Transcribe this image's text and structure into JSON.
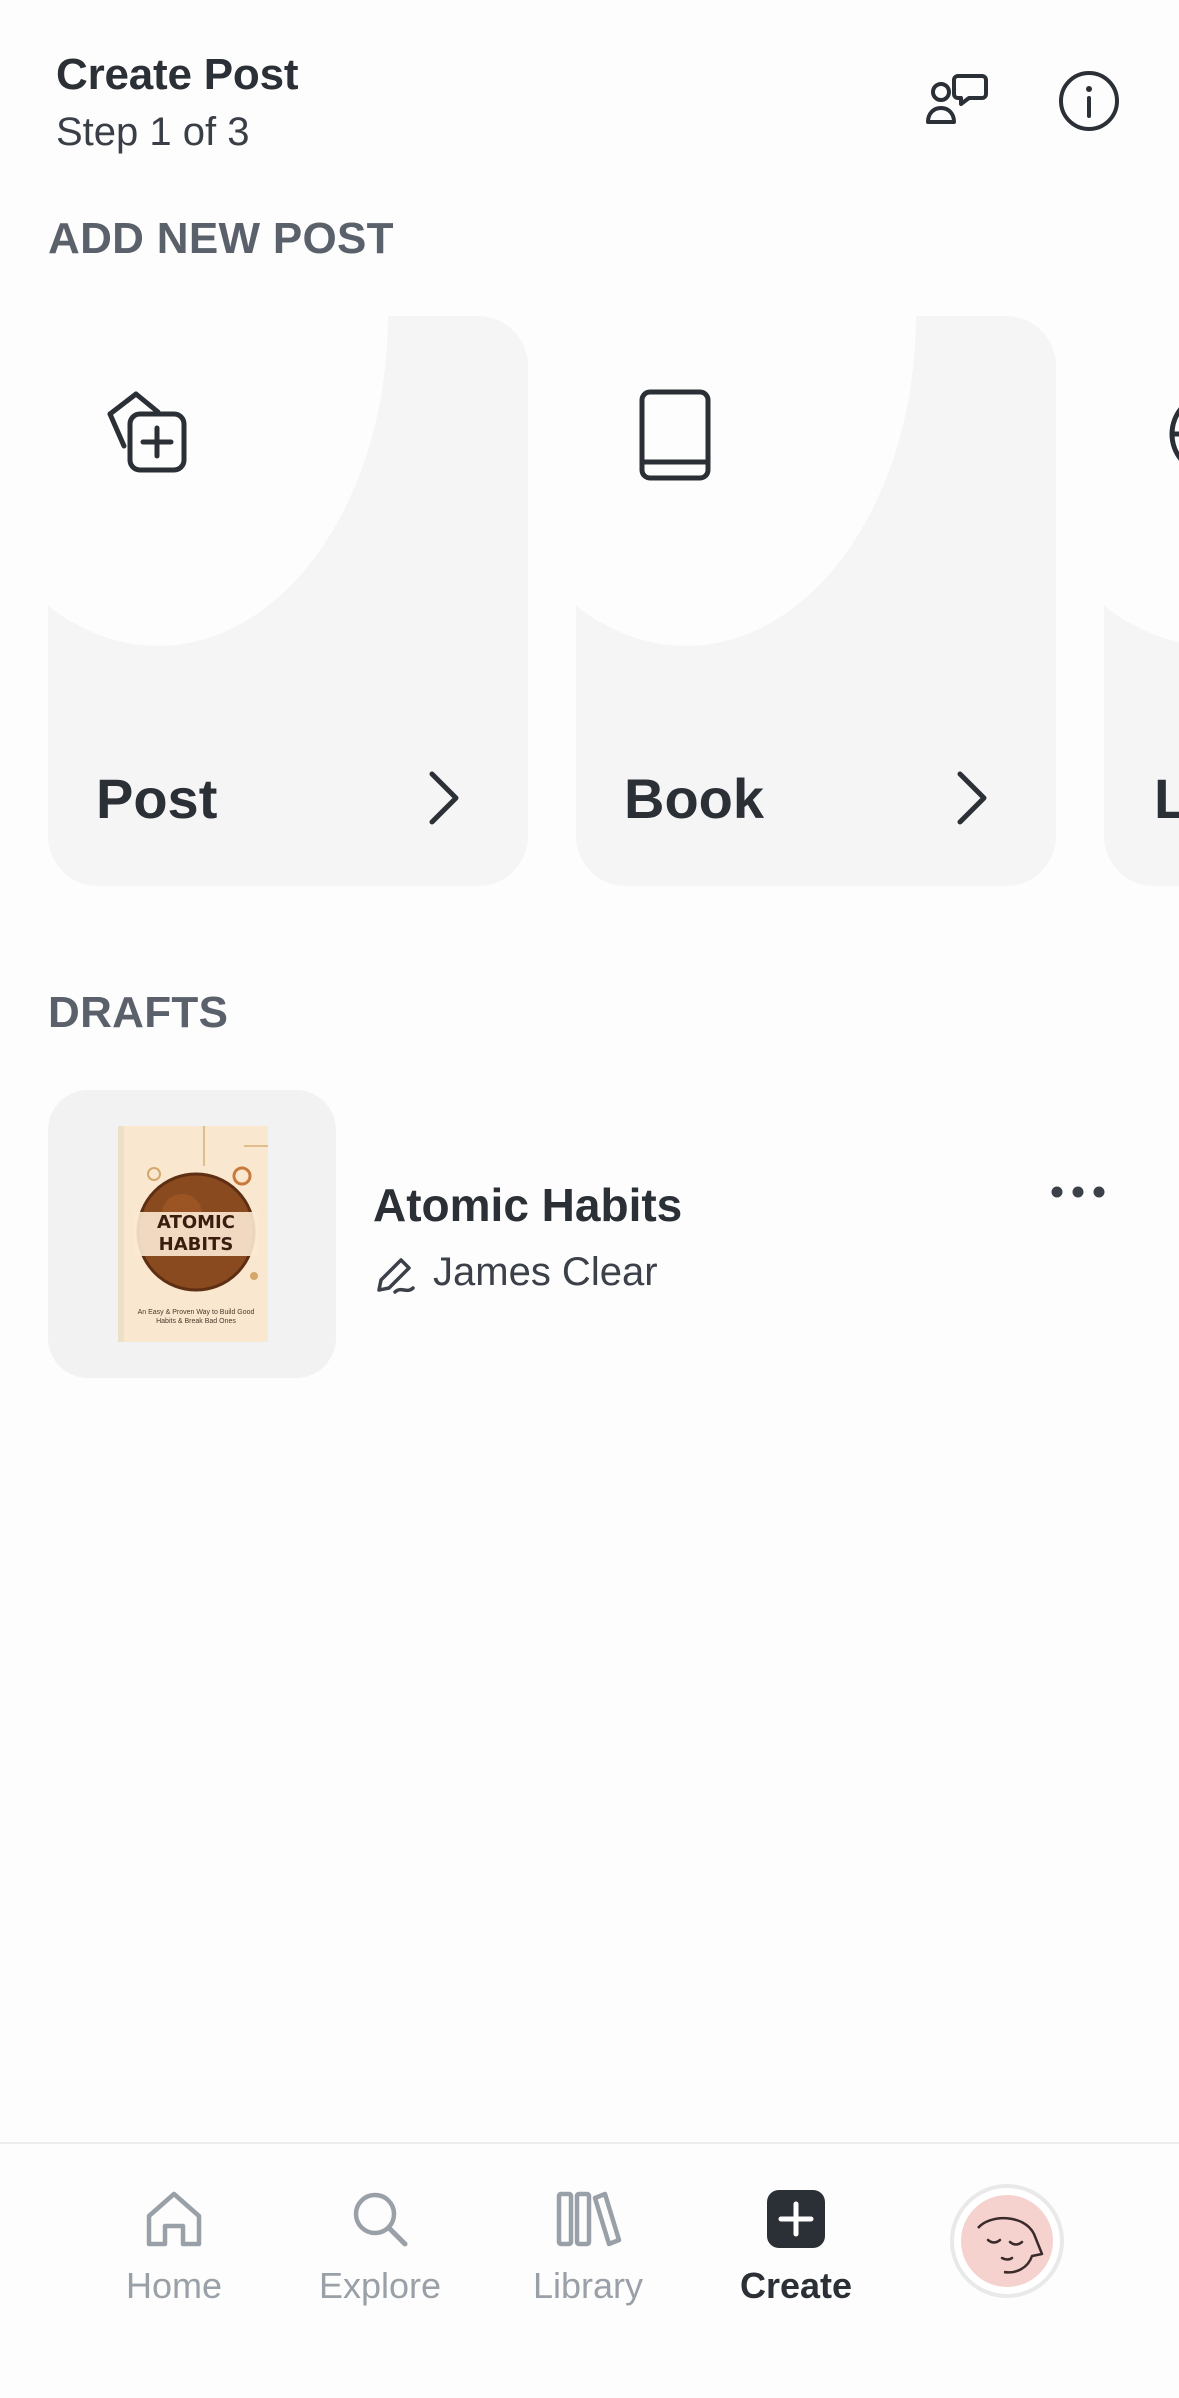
{
  "header": {
    "title": "Create Post",
    "step": "Step 1 of 3"
  },
  "sections": {
    "add_new": "ADD NEW POST",
    "drafts": "DRAFTS"
  },
  "cards": [
    {
      "label": "Post",
      "icon": "add-post-icon"
    },
    {
      "label": "Book",
      "icon": "book-icon"
    },
    {
      "label": "L",
      "icon": "globe-icon"
    }
  ],
  "drafts": [
    {
      "title": "Atomic Habits",
      "author": "James Clear",
      "cover": {
        "title_line1": "ATOMIC",
        "title_line2": "HABITS",
        "subtitle": "An Easy & Proven Way to Build Good Habits & Break Bad Ones"
      }
    }
  ],
  "tabs": [
    {
      "label": "Home",
      "icon": "home-icon"
    },
    {
      "label": "Explore",
      "icon": "search-icon"
    },
    {
      "label": "Library",
      "icon": "library-icon"
    },
    {
      "label": "Create",
      "icon": "create-icon",
      "active": true
    }
  ],
  "colors": {
    "card_bg": "#f5f5f5",
    "text": "#2b2f36",
    "muted": "#9aa0a7",
    "avatar_bg": "#f6d2cf"
  }
}
